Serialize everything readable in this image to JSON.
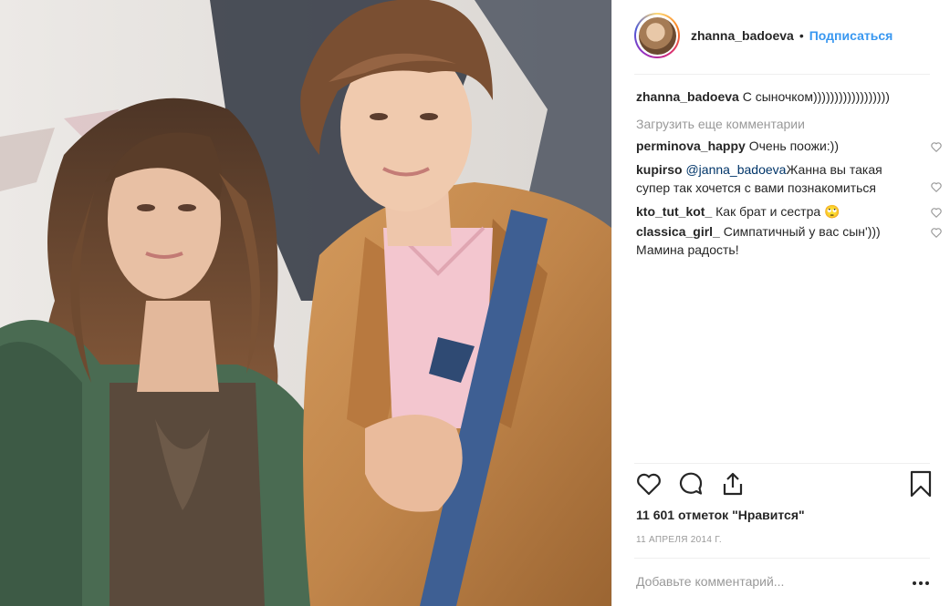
{
  "header": {
    "username": "zhanna_badoeva",
    "separator": "•",
    "follow_label": "Подписаться"
  },
  "caption": {
    "username": "zhanna_badoeva",
    "text": "С сыночком))))))))))))))))))"
  },
  "load_more_label": "Загрузить еще комментарии",
  "comments": [
    {
      "username": "perminova_happy",
      "text": "Очень поожи:))"
    },
    {
      "username": "kupirso",
      "mention": "@janna_badoeva",
      "text": "Жанна вы такая супер так хочется с вами познакомиться"
    },
    {
      "username": "kto_tut_kot_",
      "text": "Как брат и сестра 🙄"
    },
    {
      "username": "classica_girl_",
      "text": "Симпатичный у вас сын')))  Мамина радость!"
    }
  ],
  "likes_text": "11 601 отметок \"Нравится\"",
  "date_text": "11 апреля 2014 г.",
  "add_comment_placeholder": "Добавьте комментарий...",
  "icons": {
    "like": "heart-icon",
    "comment": "comment-icon",
    "share": "share-icon",
    "save": "bookmark-icon",
    "more": "more-icon"
  },
  "colors": {
    "accent": "#3897f0",
    "text": "#262626",
    "muted": "#999999",
    "divider": "#efefef"
  }
}
